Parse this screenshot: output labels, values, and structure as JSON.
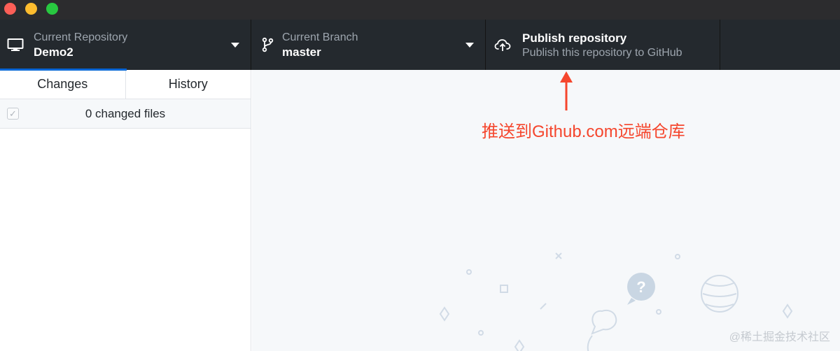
{
  "window": {
    "controls": [
      "close",
      "minimize",
      "maximize"
    ]
  },
  "toolbar": {
    "repository": {
      "label": "Current Repository",
      "value": "Demo2",
      "icon": "computer-icon"
    },
    "branch": {
      "label": "Current Branch",
      "value": "master",
      "icon": "git-branch-icon"
    },
    "publish": {
      "title": "Publish repository",
      "subtitle": "Publish this repository to GitHub",
      "icon": "cloud-upload-icon"
    }
  },
  "sidebar": {
    "tabs": [
      {
        "label": "Changes",
        "active": true
      },
      {
        "label": "History",
        "active": false
      }
    ],
    "changed_files": "0 changed files",
    "select_all_checked": true
  },
  "annotation": {
    "text": "推送到Github.com远端仓库",
    "color": "#f5462d"
  },
  "watermark": "@稀土掘金技术社区",
  "colors": {
    "toolbar": "#24292e",
    "accent": "#0366d6",
    "main_bg": "#f6f8fa",
    "annotation": "#f5462d"
  }
}
